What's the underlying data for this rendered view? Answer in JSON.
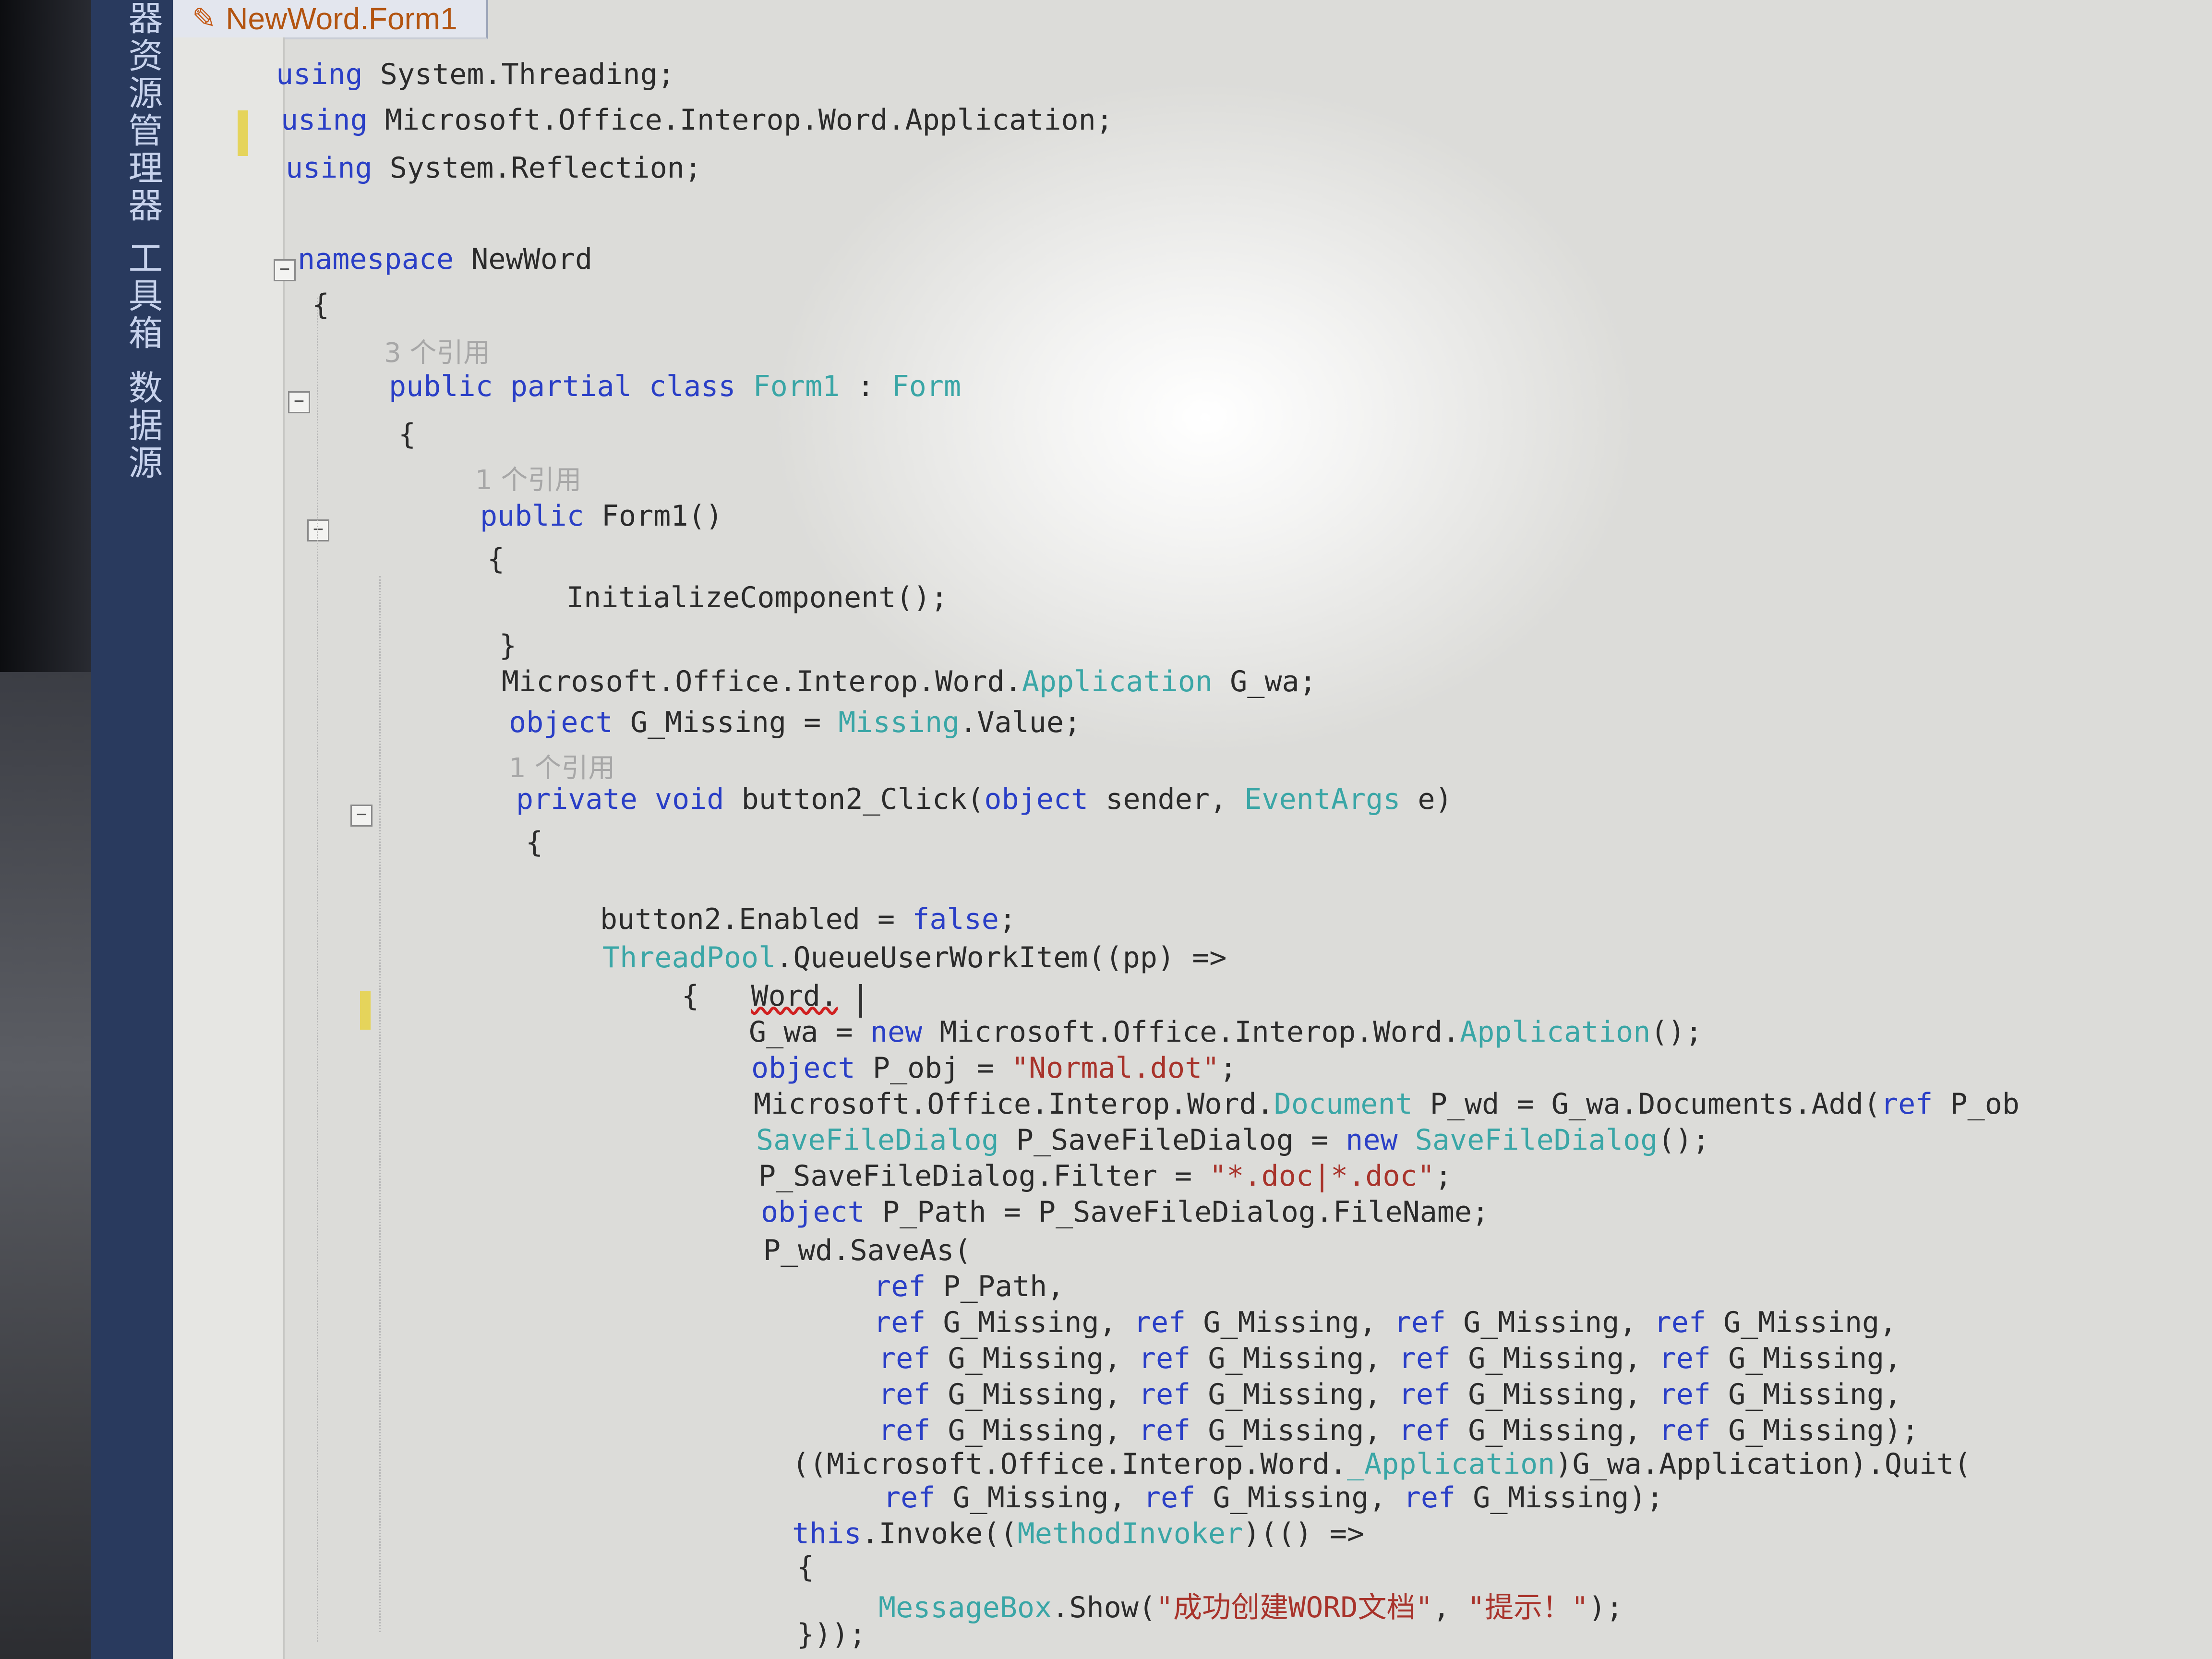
{
  "tab": {
    "title": "NewWord.Form1"
  },
  "sidebar": {
    "tabs": [
      "器资源管理器",
      "工具箱",
      "数据源"
    ]
  },
  "code_lines": [
    "using System.Threading;",
    "using Microsoft.Office.Interop.Word.Application;",
    "using System.Reflection;",
    "namespace NewWord",
    "{",
    "3 个引用",
    "public partial class Form1 : Form",
    "{",
    "1 个引用",
    "public Form1()",
    "{",
    "InitializeComponent();",
    "}",
    "Microsoft.Office.Interop.Word.Application G_wa;",
    "object G_Missing = Missing.Value;",
    "1 个引用",
    "private void button2_Click(object sender, EventArgs e)",
    "{",
    "button2.Enabled = false;",
    "ThreadPool.QueueUserWorkItem((pp) =>",
    "{   Word.|",
    "G_wa = new Microsoft.Office.Interop.Word.Application();",
    "object P_obj = \"Normal.dot\";",
    "Microsoft.Office.Interop.Word.Document P_wd = G_wa.Documents.Add(ref P_ob",
    "SaveFileDialog P_SaveFileDialog = new SaveFileDialog();",
    "P_SaveFileDialog.Filter = \"*.doc|*.doc\";",
    "object P_Path = P_SaveFileDialog.FileName;",
    "P_wd.SaveAs(",
    "ref P_Path,",
    "ref G_Missing, ref G_Missing, ref G_Missing, ref G_Missing,",
    "ref G_Missing, ref G_Missing, ref G_Missing, ref G_Missing,",
    "ref G_Missing, ref G_Missing, ref G_Missing, ref G_Missing,",
    "ref G_Missing, ref G_Missing, ref G_Missing, ref G_Missing);",
    "((Microsoft.Office.Interop.Word._Application)G_wa.Application).Quit(",
    "ref G_Missing, ref G_Missing, ref G_Missing);",
    "this.Invoke((MethodInvoker)(() =>",
    "{",
    "MessageBox.Show(\"成功创建WORD文档\", \"提示！\");",
    "}));"
  ],
  "colors": {
    "keyword": "#2a3fc6",
    "type": "#3aa6a6",
    "string": "#a8332b",
    "codelens": "#a7a7a7",
    "sidebar": "#293a5e",
    "tab_title": "#b35410"
  },
  "icons": [
    "tab-pin-icon",
    "fold-icon",
    "keyboard-icon"
  ]
}
